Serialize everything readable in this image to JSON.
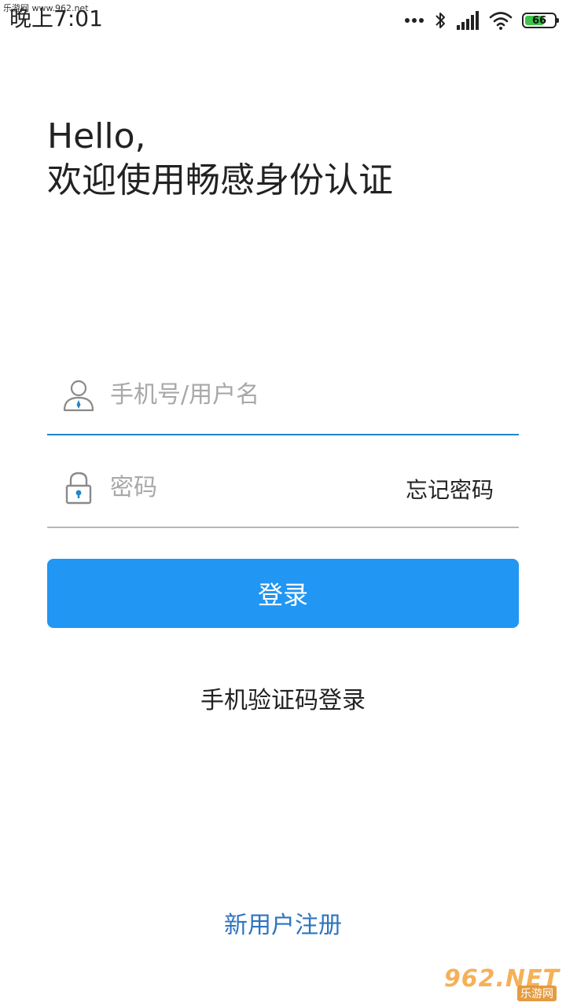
{
  "watermark": {
    "top_left": "乐游网 www.962.net",
    "bottom_right_main": "962.NET",
    "bottom_right_sub": "乐游网"
  },
  "status_bar": {
    "time": "晚上7:01",
    "icons": [
      "more-dots-icon",
      "bluetooth-icon",
      "signal-icon",
      "wifi-icon",
      "battery-icon"
    ],
    "battery_level": "66",
    "battery_fraction": 0.66,
    "battery_color": "#3fc34a"
  },
  "greeting": {
    "line1": "Hello,",
    "line2": "欢迎使用畅感身份认证"
  },
  "form": {
    "username": {
      "icon": "user-icon",
      "placeholder": "手机号/用户名",
      "value": "",
      "underline_color": "#1f86c9"
    },
    "password": {
      "icon": "lock-icon",
      "placeholder": "密码",
      "value": "",
      "forgot_label": "忘记密码"
    },
    "login_label": "登录",
    "login_color": "#2196f3",
    "sms_login_label": "手机验证码登录"
  },
  "footer": {
    "register_label": "新用户注册",
    "register_color": "#2f74c0"
  }
}
